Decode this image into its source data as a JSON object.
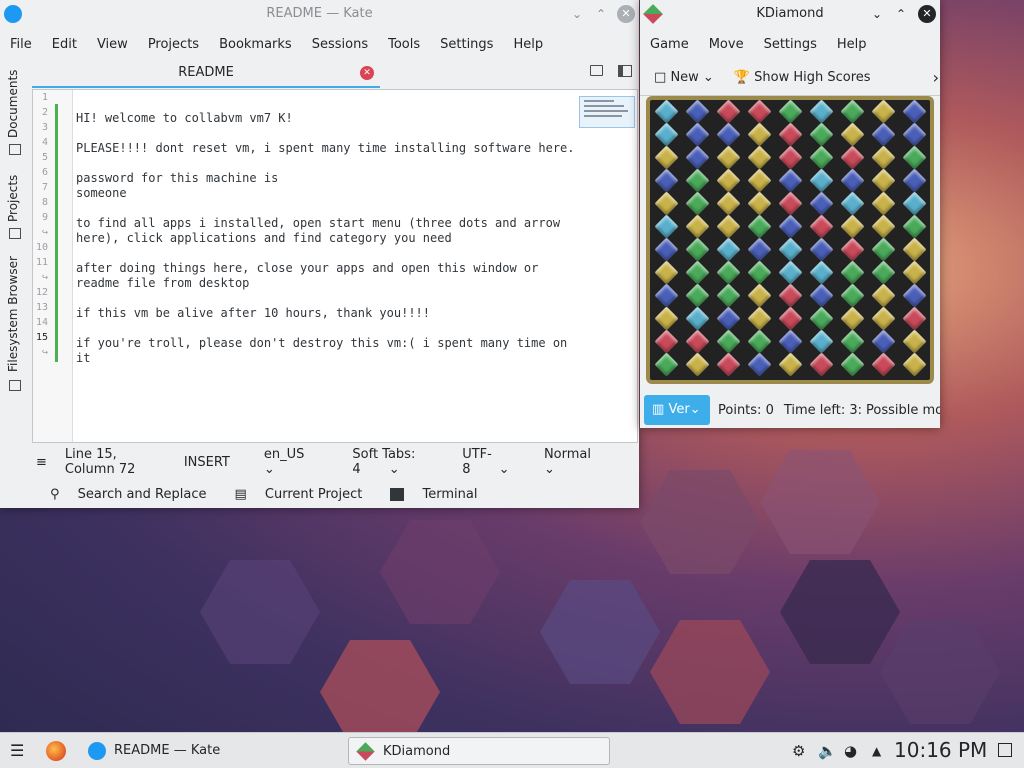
{
  "kate": {
    "title": "README — Kate",
    "menu": [
      "File",
      "Edit",
      "View",
      "Projects",
      "Bookmarks",
      "Sessions",
      "Tools",
      "Settings",
      "Help"
    ],
    "tab": "README",
    "sidebar": [
      "Documents",
      "Projects",
      "Filesystem Browser"
    ],
    "gutter": [
      "1",
      "2",
      "3",
      "4",
      "5",
      "6",
      "7",
      "8",
      "9",
      "↪",
      "10",
      "11",
      "↪",
      "12",
      "13",
      "14",
      "15",
      "↪"
    ],
    "lines": [
      "",
      "HI! welcome to collabvm vm7 K!",
      "",
      "PLEASE!!!! dont reset vm, i spent many time installing software here.",
      "",
      "password for this machine is",
      "someone",
      "",
      "to find all apps i installed, open start menu (three dots and arrow",
      "here), click applications and find category you need",
      "",
      "after doing things here, close your apps and open this window or",
      "readme file from desktop",
      "",
      "if this vm be alive after 10 hours, thank you!!!!",
      "",
      "if you're troll, please don't destroy this vm:( i spent many time on",
      "it"
    ],
    "status": {
      "position": "Line 15, Column 72",
      "mode": "INSERT",
      "lang": "en_US",
      "tabs": "Soft Tabs: 4",
      "enc": "UTF-8",
      "hl": "Normal"
    },
    "tools": {
      "search": "Search and Replace",
      "project": "Current Project",
      "terminal": "Terminal"
    }
  },
  "kdiamond": {
    "title": "KDiamond",
    "menu": [
      "Game",
      "Move",
      "Settings",
      "Help"
    ],
    "toolbar": {
      "new": "New",
      "scores": "Show High Scores"
    },
    "status": {
      "difficulty": "Ver",
      "points": "Points: 0",
      "time": "Time left: 3:",
      "moves": "Possible mo"
    },
    "colors": {
      "b": "#4a5fb8",
      "y": "#c9b24a",
      "r": "#c94a5a",
      "g": "#4aaa5a",
      "c": "#5ab0cc"
    },
    "grid": [
      "cbrrgcgyb",
      "cbbyrgybb",
      "ybyyrgryg",
      "bgyybcbyb",
      "ygyyrbcyc",
      "cyygbryyg",
      "bgcbcbrgy",
      "ygggccggy",
      "bggyrbgyb",
      "ycbyrgyyr",
      "rrggbcgby",
      "gyrbyrgry"
    ]
  },
  "taskbar": {
    "kate": "README — Kate",
    "kdiamond": "KDiamond",
    "clock": "10:16 PM"
  }
}
